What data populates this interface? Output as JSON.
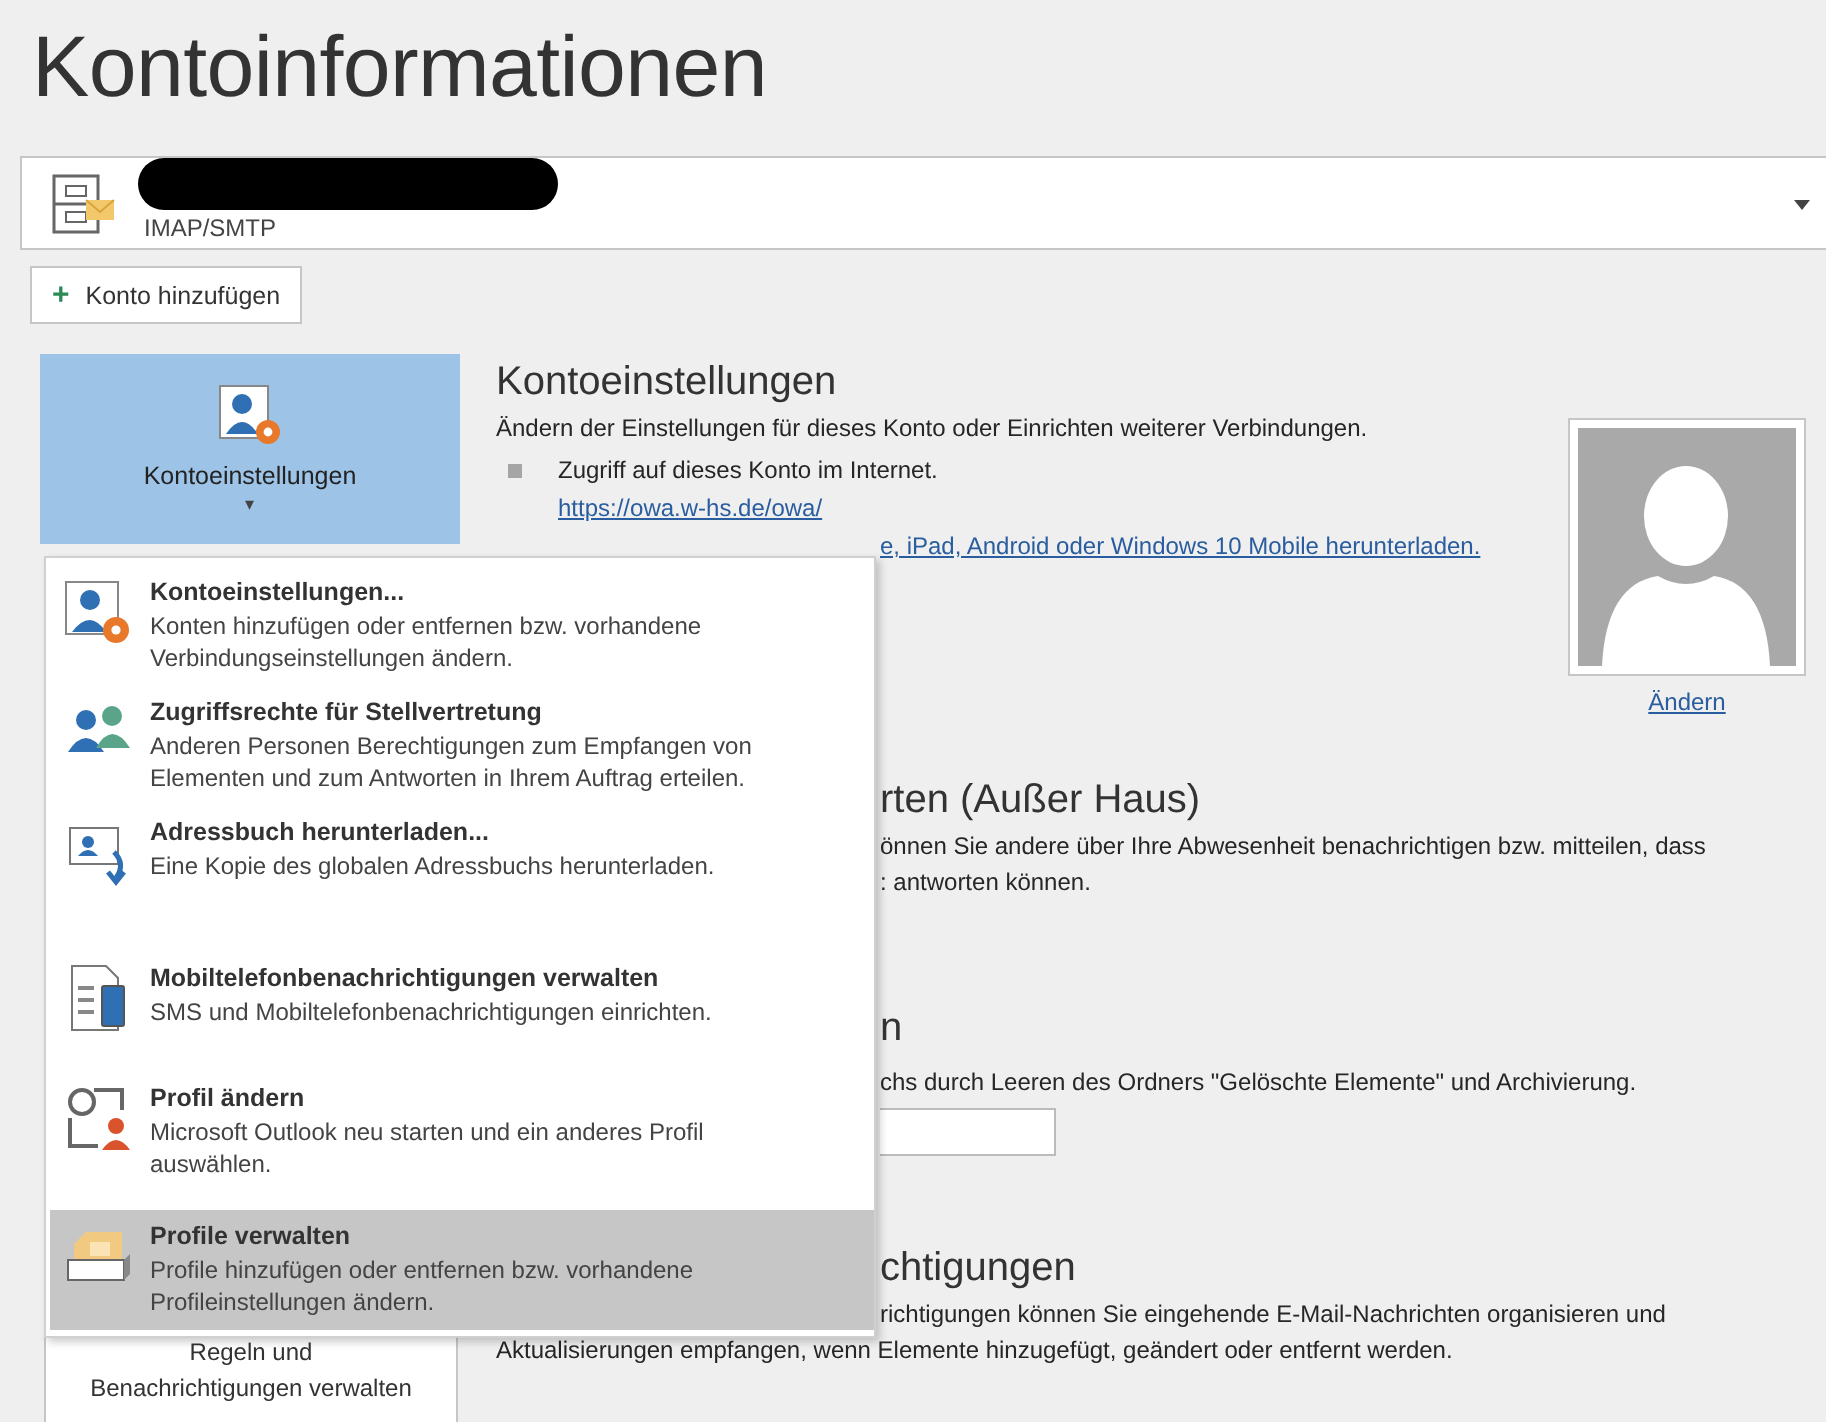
{
  "page_title": "Kontoinformationen",
  "account": {
    "type": "IMAP/SMTP"
  },
  "add_account": {
    "icon": "+",
    "label": "Konto hinzufügen"
  },
  "account_settings_tile": {
    "label": "Kontoeinstellungen",
    "caret": "▾",
    "selected": true
  },
  "account_settings": {
    "heading": "Kontoeinstellungen",
    "description": "Ändern der Einstellungen für dieses Konto oder Einrichten weiterer Verbindungen.",
    "bullet": "Zugriff auf dieses Konto im Internet.",
    "link": "https://owa.w-hs.de/owa/",
    "link_2": "e, iPad, Android oder Windows 10 Mobile herunterladen."
  },
  "photo": {
    "change_link": "Ändern"
  },
  "out_of_office": {
    "heading": "rten (Außer Haus)",
    "lines": [
      "önnen Sie andere über Ihre Abwesenheit benachrichtigen bzw. mitteilen, dass",
      ": antworten können."
    ]
  },
  "cleanup": {
    "heading": "n",
    "description": "chs durch Leeren des Ordners \"Gelöschte Elemente\" und Archivierung."
  },
  "rules": {
    "heading": "chtigungen",
    "lines": [
      "richtigungen können Sie eingehende E-Mail-Nachrichten organisieren und",
      "Aktualisierungen empfangen, wenn Elemente hinzugefügt, geändert oder entfernt werden."
    ],
    "button": [
      "Regeln und",
      "Benachrichtigungen verwalten"
    ]
  },
  "menu": [
    {
      "title": "Kontoeinstellungen...",
      "description": "Konten hinzufügen oder entfernen bzw. vorhandene Verbindungseinstellungen ändern.",
      "selected": false
    },
    {
      "title": "Zugriffsrechte für Stellvertretung",
      "description": "Anderen Personen Berechtigungen zum Empfangen von Elementen und zum Antworten in Ihrem Auftrag erteilen.",
      "selected": false
    },
    {
      "title": "Adressbuch herunterladen...",
      "description": "Eine Kopie des globalen Adressbuchs herunterladen.",
      "selected": false
    },
    {
      "title": "Mobiltelefonbenachrichtigungen verwalten",
      "description": "SMS und Mobiltelefonbenachrichtigungen einrichten.",
      "selected": false
    },
    {
      "title": "Profil ändern",
      "description": "Microsoft Outlook neu starten und ein anderes Profil auswählen.",
      "selected": false
    },
    {
      "title": "Profile verwalten",
      "description": "Profile hinzufügen oder entfernen bzw. vorhandene Profileinstellungen ändern.",
      "selected": true
    }
  ]
}
